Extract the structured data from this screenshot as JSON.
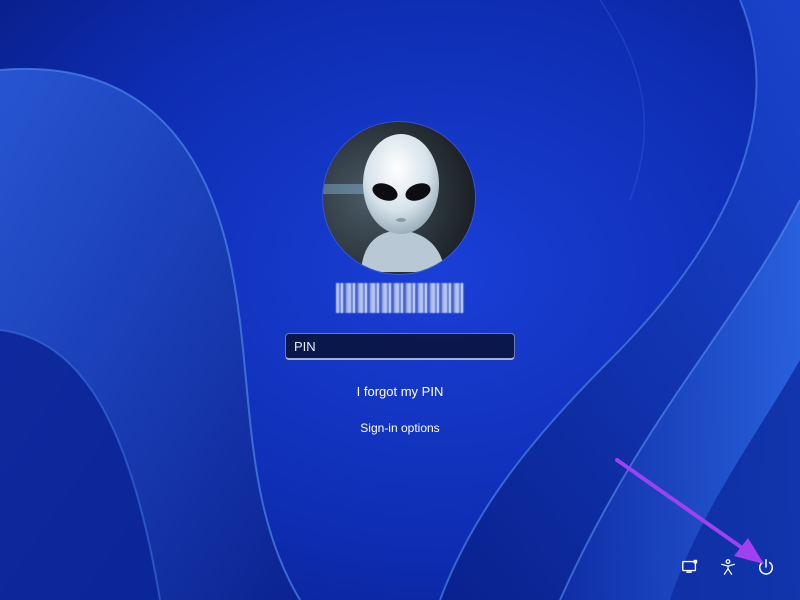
{
  "user": {
    "username": "",
    "avatar_icon": "alien-avatar"
  },
  "pin": {
    "placeholder": "PIN",
    "value": ""
  },
  "links": {
    "forgot_pin": "I forgot my PIN",
    "signin_options": "Sign-in options"
  },
  "tray": {
    "network_icon": "network-icon",
    "accessibility_icon": "accessibility-icon",
    "power_icon": "power-icon"
  },
  "colors": {
    "wallpaper_base": "#0a2aa8",
    "accent_arrow": "#a040f0"
  }
}
